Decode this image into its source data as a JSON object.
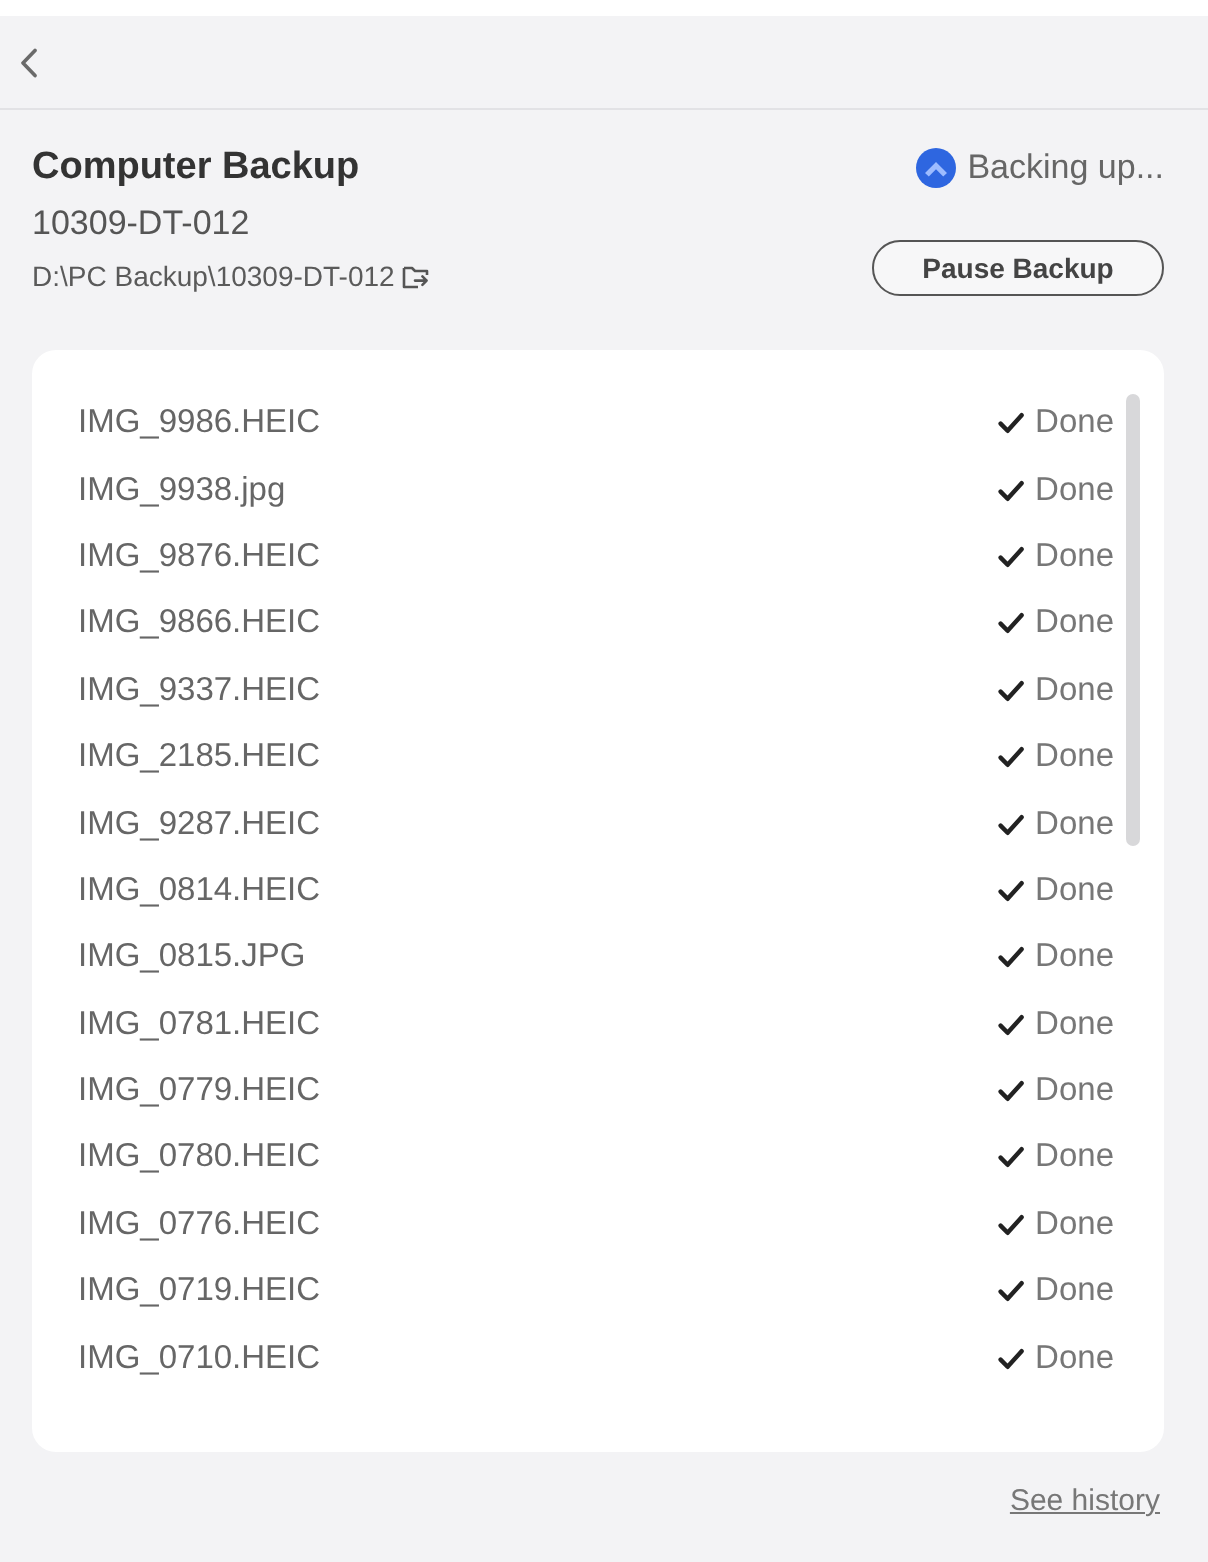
{
  "backup": {
    "title": "Computer Backup",
    "device": "10309-DT-012",
    "path": "D:\\PC Backup\\10309-DT-012",
    "status": "Backing up...",
    "pause_button": "Pause Backup"
  },
  "files": [
    {
      "name": "IMG_9986.HEIC",
      "status": "Done"
    },
    {
      "name": "IMG_9938.jpg",
      "status": "Done"
    },
    {
      "name": "IMG_9876.HEIC",
      "status": "Done"
    },
    {
      "name": "IMG_9866.HEIC",
      "status": "Done"
    },
    {
      "name": "IMG_9337.HEIC",
      "status": "Done"
    },
    {
      "name": "IMG_2185.HEIC",
      "status": "Done"
    },
    {
      "name": "IMG_9287.HEIC",
      "status": "Done"
    },
    {
      "name": "IMG_0814.HEIC",
      "status": "Done"
    },
    {
      "name": "IMG_0815.JPG",
      "status": "Done"
    },
    {
      "name": "IMG_0781.HEIC",
      "status": "Done"
    },
    {
      "name": "IMG_0779.HEIC",
      "status": "Done"
    },
    {
      "name": "IMG_0780.HEIC",
      "status": "Done"
    },
    {
      "name": "IMG_0776.HEIC",
      "status": "Done"
    },
    {
      "name": "IMG_0719.HEIC",
      "status": "Done"
    },
    {
      "name": "IMG_0710.HEIC",
      "status": "Done"
    }
  ],
  "footer": {
    "history_link": "See history"
  }
}
